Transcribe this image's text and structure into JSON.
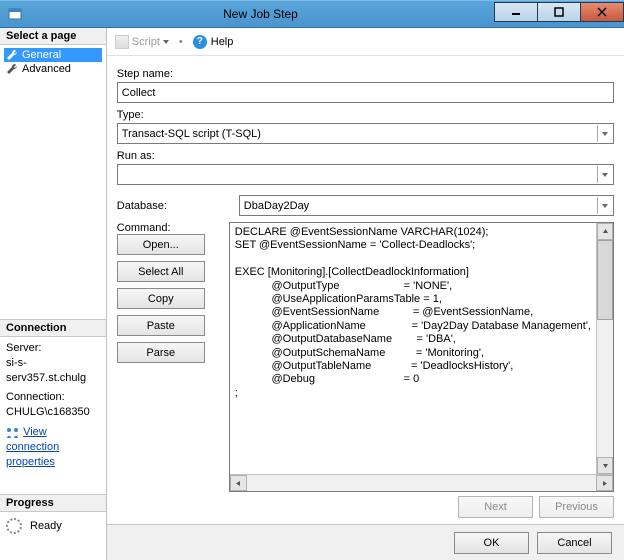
{
  "window": {
    "title": "New Job Step"
  },
  "left": {
    "select_page_hdr": "Select a page",
    "nav": {
      "general": "General",
      "advanced": "Advanced"
    },
    "connection_hdr": "Connection",
    "server_label": "Server:",
    "server_value": "si-s-serv357.st.chulg",
    "conn_label": "Connection:",
    "conn_value": "CHULG\\c168350",
    "view_conn_props": "View connection properties",
    "progress_hdr": "Progress",
    "ready": "Ready"
  },
  "toolbar": {
    "script": "Script",
    "help": "Help"
  },
  "form": {
    "step_name_label": "Step name:",
    "step_name_value": "Collect",
    "type_label": "Type:",
    "type_value": "Transact-SQL script (T-SQL)",
    "run_as_label": "Run as:",
    "run_as_value": "",
    "database_label": "Database:",
    "database_value": "DbaDay2Day",
    "command_label": "Command:",
    "command_text": "DECLARE @EventSessionName VARCHAR(1024);\nSET @EventSessionName = 'Collect-Deadlocks';\n\nEXEC [Monitoring].[CollectDeadlockInformation]\n            @OutputType                     = 'NONE',\n            @UseApplicationParamsTable = 1,\n            @EventSessionName           = @EventSessionName,\n            @ApplicationName               = 'Day2Day Database Management',\n            @OutputDatabaseName        = 'DBA',\n            @OutputSchemaName          = 'Monitoring',\n            @OutputTableName             = 'DeadlocksHistory',\n            @Debug                             = 0\n;",
    "buttons": {
      "open": "Open...",
      "select_all": "Select All",
      "copy": "Copy",
      "paste": "Paste",
      "parse": "Parse"
    },
    "nav_buttons": {
      "next": "Next",
      "previous": "Previous"
    }
  },
  "footer": {
    "ok": "OK",
    "cancel": "Cancel"
  }
}
